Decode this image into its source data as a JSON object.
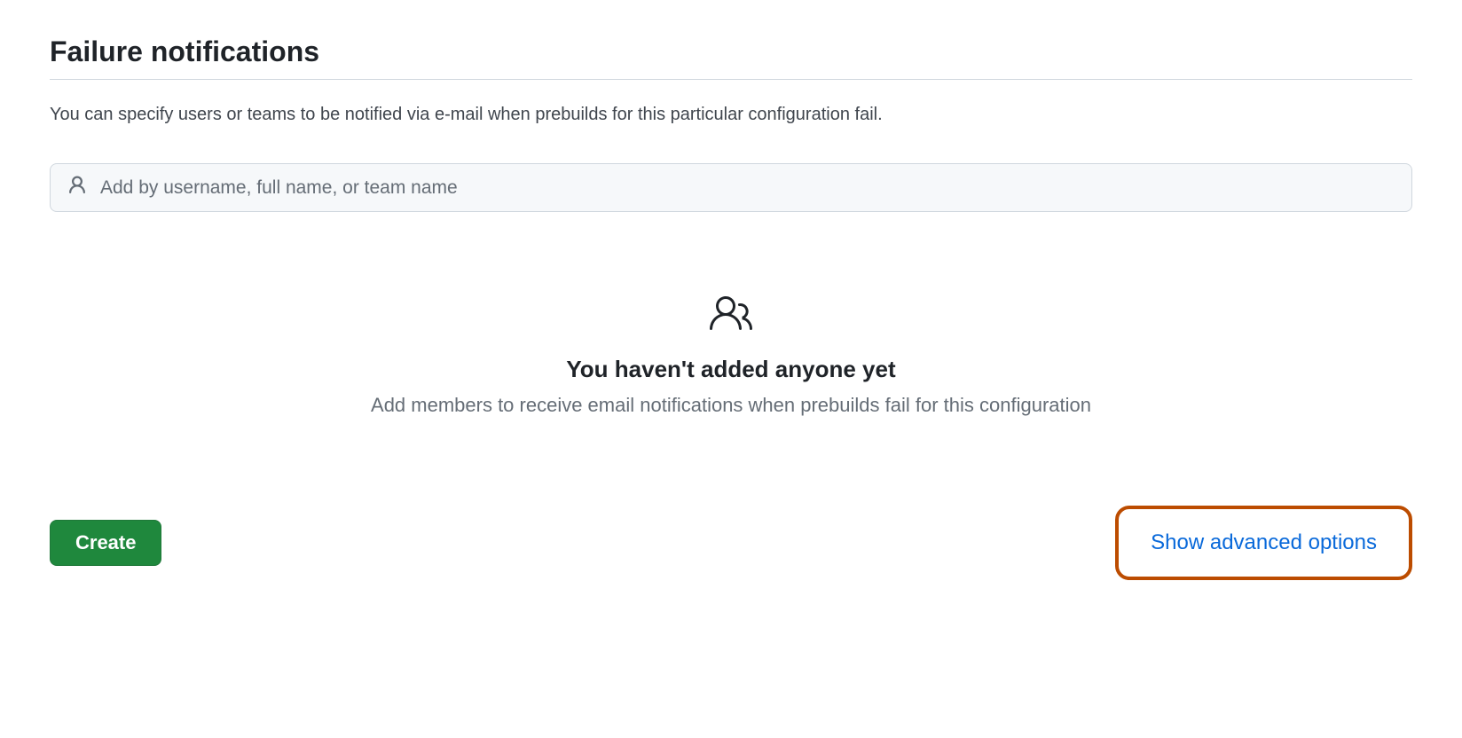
{
  "section": {
    "title": "Failure notifications",
    "description": "You can specify users or teams to be notified via e-mail when prebuilds for this particular configuration fail."
  },
  "search": {
    "placeholder": "Add by username, full name, or team name",
    "value": ""
  },
  "empty_state": {
    "title": "You haven't added anyone yet",
    "subtitle": "Add members to receive email notifications when prebuilds fail for this configuration"
  },
  "footer": {
    "create_label": "Create",
    "advanced_label": "Show advanced options"
  }
}
